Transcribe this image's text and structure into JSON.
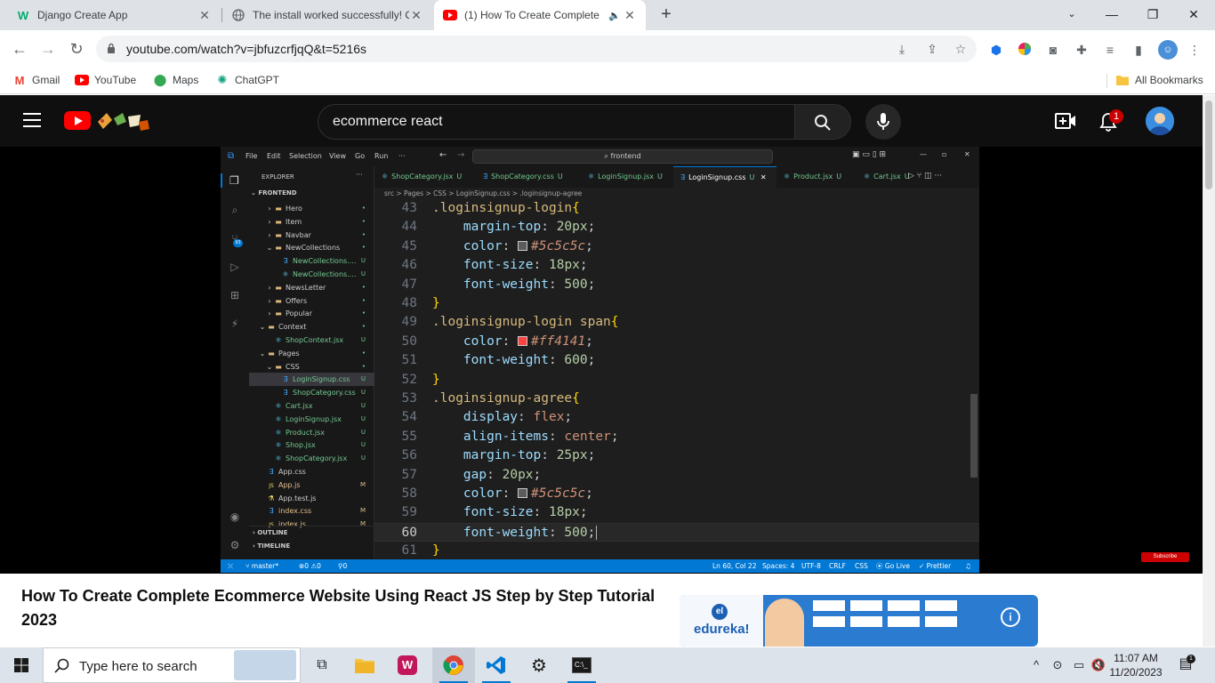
{
  "browser": {
    "tabs": [
      {
        "title": "Django Create App",
        "active": false
      },
      {
        "title": "The install worked successfully! Co",
        "active": false
      },
      {
        "title": "(1) How To Create Complete",
        "active": true
      }
    ],
    "url": "youtube.com/watch?v=jbfuzcrfjqQ&t=5216s",
    "bookmarks": [
      "Gmail",
      "YouTube",
      "Maps",
      "ChatGPT"
    ],
    "all_bookmarks": "All Bookmarks"
  },
  "youtube": {
    "search_query": "ecommerce react",
    "notification_count": "1",
    "video_title": "How To Create Complete Ecommerce Website Using React JS Step by Step Tutorial 2023",
    "subscribe_watermark": "Subscribe",
    "ad_brand": "edureka!"
  },
  "vscode": {
    "menu": [
      "File",
      "Edit",
      "Selection",
      "View",
      "Go",
      "Run",
      "···"
    ],
    "command_center": "frontend",
    "explorer_title": "EXPLORER",
    "root_folder": "FRONTEND",
    "tree": [
      {
        "label": "Hero",
        "kind": "folder",
        "indent": 2,
        "badge": "•",
        "chev": ">"
      },
      {
        "label": "Item",
        "kind": "folder",
        "indent": 2,
        "badge": "•",
        "chev": ">"
      },
      {
        "label": "Navbar",
        "kind": "folder",
        "indent": 2,
        "badge": "•",
        "chev": ">"
      },
      {
        "label": "NewCollections",
        "kind": "folder",
        "indent": 2,
        "badge": "•",
        "chev": "v"
      },
      {
        "label": "NewCollections....",
        "kind": "css",
        "indent": 3,
        "badge": "U",
        "chev": ""
      },
      {
        "label": "NewCollections....",
        "kind": "react",
        "indent": 3,
        "badge": "U",
        "chev": ""
      },
      {
        "label": "NewsLetter",
        "kind": "folder",
        "indent": 2,
        "badge": "•",
        "chev": ">"
      },
      {
        "label": "Offers",
        "kind": "folder",
        "indent": 2,
        "badge": "•",
        "chev": ">"
      },
      {
        "label": "Popular",
        "kind": "folder",
        "indent": 2,
        "badge": "•",
        "chev": ">"
      },
      {
        "label": "Context",
        "kind": "folder",
        "indent": 1,
        "badge": "•",
        "chev": "v"
      },
      {
        "label": "ShopContext.jsx",
        "kind": "react",
        "indent": 2,
        "badge": "U",
        "chev": ""
      },
      {
        "label": "Pages",
        "kind": "folder",
        "indent": 1,
        "badge": "•",
        "chev": "v"
      },
      {
        "label": "CSS",
        "kind": "folder",
        "indent": 2,
        "badge": "•",
        "chev": "v"
      },
      {
        "label": "LoginSignup.css",
        "kind": "css",
        "indent": 3,
        "badge": "U",
        "chev": "",
        "selected": true
      },
      {
        "label": "ShopCategory.css",
        "kind": "css",
        "indent": 3,
        "badge": "U",
        "chev": ""
      },
      {
        "label": "Cart.jsx",
        "kind": "react",
        "indent": 2,
        "badge": "U",
        "chev": ""
      },
      {
        "label": "LoginSignup.jsx",
        "kind": "react",
        "indent": 2,
        "badge": "U",
        "chev": ""
      },
      {
        "label": "Product.jsx",
        "kind": "react",
        "indent": 2,
        "badge": "U",
        "chev": ""
      },
      {
        "label": "Shop.jsx",
        "kind": "react",
        "indent": 2,
        "badge": "U",
        "chev": ""
      },
      {
        "label": "ShopCategory.jsx",
        "kind": "react",
        "indent": 2,
        "badge": "U",
        "chev": ""
      },
      {
        "label": "App.css",
        "kind": "css",
        "indent": 1,
        "badge": "",
        "chev": ""
      },
      {
        "label": "App.js",
        "kind": "js",
        "indent": 1,
        "badge": "M",
        "chev": ""
      },
      {
        "label": "App.test.js",
        "kind": "test",
        "indent": 1,
        "badge": "",
        "chev": ""
      },
      {
        "label": "index.css",
        "kind": "css",
        "indent": 1,
        "badge": "M",
        "chev": ""
      },
      {
        "label": "index.js",
        "kind": "js",
        "indent": 1,
        "badge": "M",
        "chev": ""
      }
    ],
    "outline": "OUTLINE",
    "timeline": "TIMELINE",
    "editor_tabs": [
      {
        "label": "ShopCategory.jsx",
        "kind": "react",
        "badge": "U"
      },
      {
        "label": "ShopCategory.css",
        "kind": "css",
        "badge": "U"
      },
      {
        "label": "LoginSignup.jsx",
        "kind": "react",
        "badge": "U"
      },
      {
        "label": "LoginSignup.css",
        "kind": "css",
        "badge": "U",
        "active": true
      },
      {
        "label": "Product.jsx",
        "kind": "react",
        "badge": "U"
      },
      {
        "label": "Cart.jsx",
        "kind": "react",
        "badge": "U"
      }
    ],
    "breadcrumb": "src > Pages > CSS > LoginSignup.css > .loginsignup-agree",
    "code": [
      {
        "n": "43",
        "tokens": [
          [
            "sel",
            ".loginsignup-login"
          ],
          [
            "brk",
            "{"
          ]
        ]
      },
      {
        "n": "44",
        "tokens": [
          [
            "ws",
            "    "
          ],
          [
            "prop",
            "margin-top"
          ],
          [
            "pun",
            ": "
          ],
          [
            "num",
            "20"
          ],
          [
            "unit",
            "px"
          ],
          [
            "pun",
            ";"
          ]
        ]
      },
      {
        "n": "45",
        "tokens": [
          [
            "ws",
            "    "
          ],
          [
            "prop",
            "color"
          ],
          [
            "pun",
            ": "
          ],
          [
            "swatch",
            "#5c5c5c"
          ],
          [
            "col",
            "#5c5c5c"
          ],
          [
            "pun",
            ";"
          ]
        ]
      },
      {
        "n": "46",
        "tokens": [
          [
            "ws",
            "    "
          ],
          [
            "prop",
            "font-size"
          ],
          [
            "pun",
            ": "
          ],
          [
            "num",
            "18"
          ],
          [
            "unit",
            "px"
          ],
          [
            "pun",
            ";"
          ]
        ]
      },
      {
        "n": "47",
        "tokens": [
          [
            "ws",
            "    "
          ],
          [
            "prop",
            "font-weight"
          ],
          [
            "pun",
            ": "
          ],
          [
            "num",
            "500"
          ],
          [
            "pun",
            ";"
          ]
        ]
      },
      {
        "n": "48",
        "tokens": [
          [
            "brk",
            "}"
          ]
        ]
      },
      {
        "n": "49",
        "tokens": [
          [
            "sel",
            ".loginsignup-login span"
          ],
          [
            "brk",
            "{"
          ]
        ]
      },
      {
        "n": "50",
        "tokens": [
          [
            "ws",
            "    "
          ],
          [
            "prop",
            "color"
          ],
          [
            "pun",
            ": "
          ],
          [
            "swatch",
            "#ff4141"
          ],
          [
            "col",
            "#ff4141"
          ],
          [
            "pun",
            ";"
          ]
        ]
      },
      {
        "n": "51",
        "tokens": [
          [
            "ws",
            "    "
          ],
          [
            "prop",
            "font-weight"
          ],
          [
            "pun",
            ": "
          ],
          [
            "num",
            "600"
          ],
          [
            "pun",
            ";"
          ]
        ]
      },
      {
        "n": "52",
        "tokens": [
          [
            "brk",
            "}"
          ]
        ]
      },
      {
        "n": "53",
        "tokens": [
          [
            "sel",
            ".loginsignup-agree"
          ],
          [
            "brk",
            "{"
          ]
        ]
      },
      {
        "n": "54",
        "tokens": [
          [
            "ws",
            "    "
          ],
          [
            "prop",
            "display"
          ],
          [
            "pun",
            ": "
          ],
          [
            "kw",
            "flex"
          ],
          [
            "pun",
            ";"
          ]
        ]
      },
      {
        "n": "55",
        "tokens": [
          [
            "ws",
            "    "
          ],
          [
            "prop",
            "align-items"
          ],
          [
            "pun",
            ": "
          ],
          [
            "kw",
            "center"
          ],
          [
            "pun",
            ";"
          ]
        ]
      },
      {
        "n": "56",
        "tokens": [
          [
            "ws",
            "    "
          ],
          [
            "prop",
            "margin-top"
          ],
          [
            "pun",
            ": "
          ],
          [
            "num",
            "25"
          ],
          [
            "unit",
            "px"
          ],
          [
            "pun",
            ";"
          ]
        ]
      },
      {
        "n": "57",
        "tokens": [
          [
            "ws",
            "    "
          ],
          [
            "prop",
            "gap"
          ],
          [
            "pun",
            ": "
          ],
          [
            "num",
            "20"
          ],
          [
            "unit",
            "px"
          ],
          [
            "pun",
            ";"
          ]
        ]
      },
      {
        "n": "58",
        "tokens": [
          [
            "ws",
            "    "
          ],
          [
            "prop",
            "color"
          ],
          [
            "pun",
            ": "
          ],
          [
            "swatch",
            "#5c5c5c"
          ],
          [
            "col",
            "#5c5c5c"
          ],
          [
            "pun",
            ";"
          ]
        ]
      },
      {
        "n": "59",
        "tokens": [
          [
            "ws",
            "    "
          ],
          [
            "prop",
            "font-size"
          ],
          [
            "pun",
            ": "
          ],
          [
            "num",
            "18"
          ],
          [
            "unit",
            "px"
          ],
          [
            "pun",
            ";"
          ]
        ]
      },
      {
        "n": "60",
        "tokens": [
          [
            "ws",
            "    "
          ],
          [
            "prop",
            "font-weight"
          ],
          [
            "pun",
            ": "
          ],
          [
            "num",
            "500"
          ],
          [
            "pun",
            ";"
          ]
        ],
        "current": true
      },
      {
        "n": "61",
        "tokens": [
          [
            "brk",
            "}"
          ]
        ]
      }
    ],
    "status_left": [
      "master*",
      "⊗0 ⚠0",
      "⚲0"
    ],
    "status_right": [
      "Ln 60, Col 22",
      "Spaces: 4",
      "UTF-8",
      "CRLF",
      "CSS",
      "Go Live",
      "Prettier"
    ]
  },
  "taskbar": {
    "search_placeholder": "Type here to search",
    "time": "11:07 AM",
    "date": "11/20/2023"
  },
  "colors": {
    "youtube_red": "#ff0000",
    "vscode_blue": "#0078d4",
    "chrome_tabstrip": "#dee1e6"
  }
}
